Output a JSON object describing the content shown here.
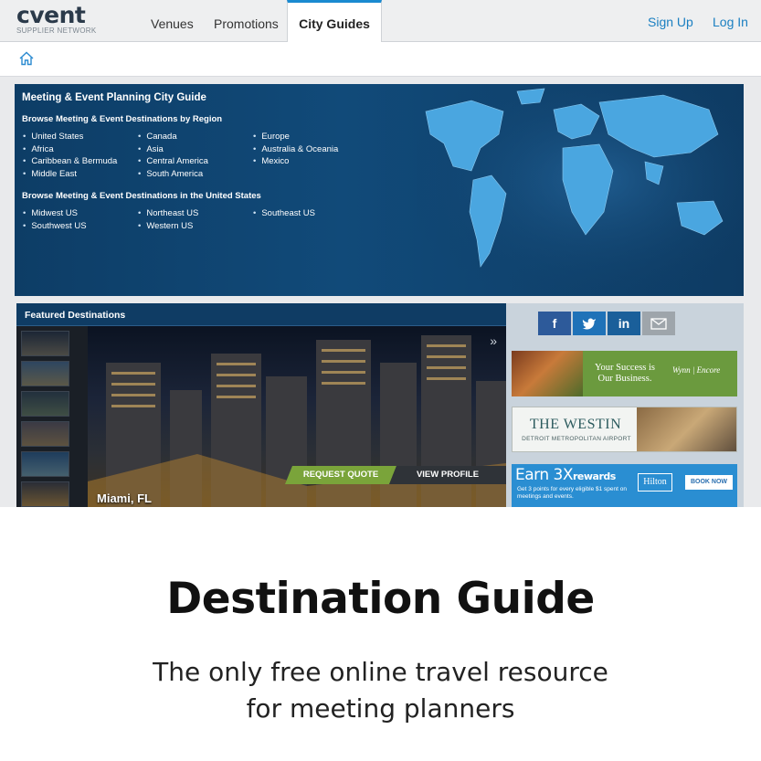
{
  "header": {
    "logo_text": "cvent",
    "logo_sub": "SUPPLIER NETWORK",
    "tabs": [
      "Venues",
      "Promotions",
      "City Guides"
    ],
    "active_tab": "City Guides",
    "sign_up": "Sign Up",
    "log_in": "Log In",
    "accent": "#1a8ad0"
  },
  "breadcrumb": {
    "icon": "home-icon"
  },
  "hero": {
    "title": "Meeting & Event Planning City Guide",
    "region_heading": "Browse Meeting & Event Destinations by Region",
    "regions": [
      [
        "United States",
        "Africa",
        "Caribbean & Bermuda",
        "Middle East"
      ],
      [
        "Canada",
        "Asia",
        "Central America",
        "South America"
      ],
      [
        "Europe",
        "Australia & Oceania",
        "Mexico"
      ]
    ],
    "us_heading": "Browse Meeting & Event Destinations in the United States",
    "us_regions": [
      [
        "Midwest US",
        "Southwest US"
      ],
      [
        "Northeast US",
        "Western US"
      ],
      [
        "Southeast US"
      ]
    ]
  },
  "featured": {
    "title": "Featured Destinations",
    "city": "Miami, FL",
    "request_quote": "REQUEST QUOTE",
    "view_profile": "VIEW PROFILE",
    "next_icon": "double-chevron-right-icon"
  },
  "social": [
    "f",
    "t",
    "in",
    "mail"
  ],
  "ads": {
    "wynn": {
      "line": "Your Success is Our Business.",
      "brand": "Wynn | Encore"
    },
    "westin": {
      "name": "THE WESTIN",
      "location": "DETROIT METROPOLITAN AIRPORT"
    },
    "hilton": {
      "earn": "Earn 3X",
      "rewards": "rewards",
      "fine": "Get 3 points for every eligible $1 spent on meetings and events.",
      "logo": "Hilton",
      "book": "BOOK NOW"
    }
  },
  "marketing": {
    "headline": "Destination Guide",
    "tagline_1": "The only free online travel resource",
    "tagline_2": "for meeting planners"
  }
}
